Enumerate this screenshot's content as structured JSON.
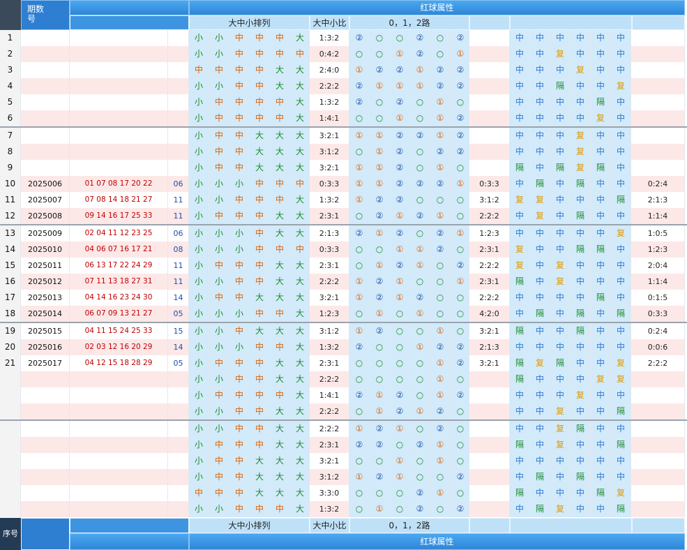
{
  "header": {
    "col_issue": "期数",
    "col_issue2": "号",
    "red_attr": "红球属性",
    "size_arrange": "大中小排列",
    "size_ratio": "大中小比",
    "route": "0，1，2路"
  },
  "footer": {
    "seq": "序号",
    "size_arrange": "大中小排列",
    "size_ratio": "大中小比",
    "route": "0，1，2路",
    "red_attr": "红球属性"
  },
  "rows": [
    {
      "seq": "1",
      "issue": "",
      "nums": "",
      "blue": "",
      "size": [
        "小",
        "小",
        "中",
        "中",
        "中",
        "大"
      ],
      "ratio": "1:3:2",
      "route": [
        "②",
        "○",
        "○",
        "②",
        "○",
        "②"
      ],
      "r2": "",
      "f": [
        "中",
        "中",
        "中",
        "中",
        "中",
        "中"
      ],
      "tail": ""
    },
    {
      "seq": "2",
      "issue": "",
      "nums": "",
      "blue": "",
      "size": [
        "小",
        "小",
        "中",
        "中",
        "中",
        "中"
      ],
      "ratio": "0:4:2",
      "route": [
        "○",
        "○",
        "①",
        "②",
        "○",
        "①"
      ],
      "r2": "",
      "f": [
        "中",
        "中",
        "复",
        "中",
        "中",
        "中"
      ],
      "tail": ""
    },
    {
      "seq": "3",
      "issue": "",
      "nums": "",
      "blue": "",
      "size": [
        "中",
        "中",
        "中",
        "中",
        "大",
        "大"
      ],
      "ratio": "2:4:0",
      "route": [
        "①",
        "②",
        "②",
        "①",
        "②",
        "②"
      ],
      "r2": "",
      "f": [
        "中",
        "中",
        "中",
        "复",
        "中",
        "中"
      ],
      "tail": ""
    },
    {
      "seq": "4",
      "issue": "",
      "nums": "",
      "blue": "",
      "size": [
        "小",
        "小",
        "中",
        "中",
        "大",
        "大"
      ],
      "ratio": "2:2:2",
      "route": [
        "②",
        "①",
        "①",
        "①",
        "②",
        "②"
      ],
      "r2": "",
      "f": [
        "中",
        "中",
        "隔",
        "中",
        "中",
        "复"
      ],
      "tail": ""
    },
    {
      "seq": "5",
      "issue": "",
      "nums": "",
      "blue": "",
      "size": [
        "小",
        "中",
        "中",
        "中",
        "中",
        "大"
      ],
      "ratio": "1:3:2",
      "route": [
        "②",
        "○",
        "②",
        "○",
        "①",
        "○"
      ],
      "r2": "",
      "f": [
        "中",
        "中",
        "中",
        "中",
        "隔",
        "中"
      ],
      "tail": ""
    },
    {
      "seq": "6",
      "issue": "",
      "nums": "",
      "blue": "",
      "size": [
        "小",
        "中",
        "中",
        "中",
        "中",
        "大"
      ],
      "ratio": "1:4:1",
      "route": [
        "○",
        "○",
        "①",
        "○",
        "①",
        "②"
      ],
      "r2": "",
      "f": [
        "中",
        "中",
        "中",
        "中",
        "复",
        "中"
      ],
      "tail": ""
    },
    {
      "seq": "7",
      "issue": "",
      "nums": "",
      "blue": "",
      "size": [
        "小",
        "中",
        "中",
        "大",
        "大",
        "大"
      ],
      "ratio": "3:2:1",
      "route": [
        "①",
        "①",
        "②",
        "②",
        "①",
        "②"
      ],
      "r2": "",
      "f": [
        "中",
        "中",
        "中",
        "复",
        "中",
        "中"
      ],
      "tail": ""
    },
    {
      "seq": "8",
      "issue": "",
      "nums": "",
      "blue": "",
      "size": [
        "小",
        "中",
        "中",
        "大",
        "大",
        "大"
      ],
      "ratio": "3:1:2",
      "route": [
        "○",
        "①",
        "②",
        "○",
        "②",
        "②"
      ],
      "r2": "",
      "f": [
        "中",
        "中",
        "中",
        "复",
        "中",
        "中"
      ],
      "tail": ""
    },
    {
      "seq": "9",
      "issue": "",
      "nums": "",
      "blue": "",
      "size": [
        "小",
        "中",
        "中",
        "大",
        "大",
        "大"
      ],
      "ratio": "3:2:1",
      "route": [
        "①",
        "①",
        "②",
        "○",
        "①",
        "○"
      ],
      "r2": "",
      "f": [
        "隔",
        "中",
        "隔",
        "复",
        "隔",
        "中"
      ],
      "tail": ""
    },
    {
      "seq": "10",
      "issue": "2025006",
      "nums": "01 07 08 17 20 22",
      "blue": "06",
      "size": [
        "小",
        "小",
        "小",
        "中",
        "中",
        "中"
      ],
      "ratio": "0:3:3",
      "route": [
        "①",
        "①",
        "②",
        "②",
        "②",
        "①"
      ],
      "r2": "0:3:3",
      "f": [
        "中",
        "隔",
        "中",
        "隔",
        "中",
        "中"
      ],
      "tail": "0:2:4"
    },
    {
      "seq": "11",
      "issue": "2025007",
      "nums": "07 08 14 18 21 27",
      "blue": "11",
      "size": [
        "小",
        "小",
        "中",
        "中",
        "中",
        "大"
      ],
      "ratio": "1:3:2",
      "route": [
        "①",
        "②",
        "②",
        "○",
        "○",
        "○"
      ],
      "r2": "3:1:2",
      "f": [
        "复",
        "复",
        "中",
        "中",
        "中",
        "隔"
      ],
      "tail": "2:1:3"
    },
    {
      "seq": "12",
      "issue": "2025008",
      "nums": "09 14 16 17 25 33",
      "blue": "11",
      "size": [
        "小",
        "中",
        "中",
        "中",
        "大",
        "大"
      ],
      "ratio": "2:3:1",
      "route": [
        "○",
        "②",
        "①",
        "②",
        "①",
        "○"
      ],
      "r2": "2:2:2",
      "f": [
        "中",
        "复",
        "中",
        "隔",
        "中",
        "中"
      ],
      "tail": "1:1:4"
    },
    {
      "seq": "13",
      "issue": "2025009",
      "nums": "02 04 11 12 23 25",
      "blue": "06",
      "size": [
        "小",
        "小",
        "小",
        "中",
        "大",
        "大"
      ],
      "ratio": "2:1:3",
      "route": [
        "②",
        "①",
        "②",
        "○",
        "②",
        "①"
      ],
      "r2": "1:2:3",
      "f": [
        "中",
        "中",
        "中",
        "中",
        "中",
        "复"
      ],
      "tail": "1:0:5"
    },
    {
      "seq": "14",
      "issue": "2025010",
      "nums": "04 06 07 16 17 21",
      "blue": "08",
      "size": [
        "小",
        "小",
        "小",
        "中",
        "中",
        "中"
      ],
      "ratio": "0:3:3",
      "route": [
        "○",
        "○",
        "①",
        "①",
        "②",
        "○"
      ],
      "r2": "2:3:1",
      "f": [
        "复",
        "中",
        "中",
        "隔",
        "隔",
        "中"
      ],
      "tail": "1:2:3"
    },
    {
      "seq": "15",
      "issue": "2025011",
      "nums": "06 13 17 22 24 29",
      "blue": "11",
      "size": [
        "小",
        "中",
        "中",
        "中",
        "大",
        "大"
      ],
      "ratio": "2:3:1",
      "route": [
        "○",
        "①",
        "②",
        "①",
        "○",
        "②"
      ],
      "r2": "2:2:2",
      "f": [
        "复",
        "中",
        "复",
        "中",
        "中",
        "中"
      ],
      "tail": "2:0:4"
    },
    {
      "seq": "16",
      "issue": "2025012",
      "nums": "07 11 13 18 27 31",
      "blue": "11",
      "size": [
        "小",
        "小",
        "中",
        "中",
        "大",
        "大"
      ],
      "ratio": "2:2:2",
      "route": [
        "①",
        "②",
        "①",
        "○",
        "○",
        "①"
      ],
      "r2": "2:3:1",
      "f": [
        "隔",
        "中",
        "复",
        "中",
        "中",
        "中"
      ],
      "tail": "1:1:4"
    },
    {
      "seq": "17",
      "issue": "2025013",
      "nums": "04 14 16 23 24 30",
      "blue": "14",
      "size": [
        "小",
        "中",
        "中",
        "大",
        "大",
        "大"
      ],
      "ratio": "3:2:1",
      "route": [
        "①",
        "②",
        "①",
        "②",
        "○",
        "○"
      ],
      "r2": "2:2:2",
      "f": [
        "中",
        "中",
        "中",
        "中",
        "隔",
        "中"
      ],
      "tail": "0:1:5"
    },
    {
      "seq": "18",
      "issue": "2025014",
      "nums": "06 07 09 13 21 27",
      "blue": "05",
      "size": [
        "小",
        "小",
        "小",
        "中",
        "中",
        "大"
      ],
      "ratio": "1:2:3",
      "route": [
        "○",
        "①",
        "○",
        "①",
        "○",
        "○"
      ],
      "r2": "4:2:0",
      "f": [
        "中",
        "隔",
        "中",
        "隔",
        "中",
        "隔"
      ],
      "tail": "0:3:3"
    },
    {
      "seq": "19",
      "issue": "2025015",
      "nums": "04 11 15 24 25 33",
      "blue": "15",
      "size": [
        "小",
        "小",
        "中",
        "大",
        "大",
        "大"
      ],
      "ratio": "3:1:2",
      "route": [
        "①",
        "②",
        "○",
        "○",
        "①",
        "○"
      ],
      "r2": "3:2:1",
      "f": [
        "隔",
        "中",
        "中",
        "隔",
        "中",
        "中"
      ],
      "tail": "0:2:4"
    },
    {
      "seq": "20",
      "issue": "2025016",
      "nums": "02 03 12 16 20 29",
      "blue": "14",
      "size": [
        "小",
        "小",
        "小",
        "中",
        "中",
        "大"
      ],
      "ratio": "1:3:2",
      "route": [
        "②",
        "○",
        "○",
        "①",
        "②",
        "②"
      ],
      "r2": "2:1:3",
      "f": [
        "中",
        "中",
        "中",
        "中",
        "中",
        "中"
      ],
      "tail": "0:0:6"
    },
    {
      "seq": "21",
      "issue": "2025017",
      "nums": "04 12 15 18 28 29",
      "blue": "05",
      "size": [
        "小",
        "中",
        "中",
        "中",
        "大",
        "大"
      ],
      "ratio": "2:3:1",
      "route": [
        "○",
        "○",
        "○",
        "○",
        "①",
        "②"
      ],
      "r2": "3:2:1",
      "f": [
        "隔",
        "复",
        "隔",
        "中",
        "中",
        "复"
      ],
      "tail": "2:2:2"
    },
    {
      "seq": "",
      "issue": "",
      "nums": "",
      "blue": "",
      "size": [
        "小",
        "小",
        "中",
        "中",
        "大",
        "大"
      ],
      "ratio": "2:2:2",
      "route": [
        "○",
        "○",
        "○",
        "○",
        "①",
        "○"
      ],
      "r2": "",
      "f": [
        "隔",
        "中",
        "中",
        "中",
        "复",
        "复"
      ],
      "tail": ""
    },
    {
      "seq": "",
      "issue": "",
      "nums": "",
      "blue": "",
      "size": [
        "小",
        "中",
        "中",
        "中",
        "中",
        "大"
      ],
      "ratio": "1:4:1",
      "route": [
        "②",
        "①",
        "②",
        "○",
        "①",
        "②"
      ],
      "r2": "",
      "f": [
        "中",
        "中",
        "中",
        "复",
        "中",
        "中"
      ],
      "tail": ""
    },
    {
      "seq": "",
      "issue": "",
      "nums": "",
      "blue": "",
      "size": [
        "小",
        "小",
        "中",
        "中",
        "大",
        "大"
      ],
      "ratio": "2:2:2",
      "route": [
        "○",
        "①",
        "②",
        "①",
        "②",
        "○"
      ],
      "r2": "",
      "f": [
        "中",
        "中",
        "复",
        "中",
        "中",
        "隔"
      ],
      "tail": ""
    },
    {
      "seq": "",
      "issue": "",
      "nums": "",
      "blue": "",
      "size": [
        "小",
        "小",
        "中",
        "中",
        "大",
        "大"
      ],
      "ratio": "2:2:2",
      "route": [
        "①",
        "②",
        "①",
        "○",
        "②",
        "○"
      ],
      "r2": "",
      "f": [
        "中",
        "中",
        "复",
        "隔",
        "中",
        "中"
      ],
      "tail": ""
    },
    {
      "seq": "",
      "issue": "",
      "nums": "",
      "blue": "",
      "size": [
        "小",
        "中",
        "中",
        "中",
        "大",
        "大"
      ],
      "ratio": "2:3:1",
      "route": [
        "②",
        "②",
        "○",
        "②",
        "①",
        "○"
      ],
      "r2": "",
      "f": [
        "隔",
        "中",
        "复",
        "中",
        "中",
        "隔"
      ],
      "tail": ""
    },
    {
      "seq": "",
      "issue": "",
      "nums": "",
      "blue": "",
      "size": [
        "小",
        "中",
        "中",
        "大",
        "大",
        "大"
      ],
      "ratio": "3:2:1",
      "route": [
        "○",
        "○",
        "①",
        "○",
        "①",
        "○"
      ],
      "r2": "",
      "f": [
        "中",
        "中",
        "中",
        "中",
        "中",
        "中"
      ],
      "tail": ""
    },
    {
      "seq": "",
      "issue": "",
      "nums": "",
      "blue": "",
      "size": [
        "小",
        "中",
        "中",
        "大",
        "大",
        "大"
      ],
      "ratio": "3:1:2",
      "route": [
        "①",
        "②",
        "①",
        "○",
        "○",
        "②"
      ],
      "r2": "",
      "f": [
        "中",
        "隔",
        "中",
        "隔",
        "中",
        "中"
      ],
      "tail": ""
    },
    {
      "seq": "",
      "issue": "",
      "nums": "",
      "blue": "",
      "size": [
        "中",
        "中",
        "中",
        "大",
        "大",
        "大"
      ],
      "ratio": "3:3:0",
      "route": [
        "○",
        "○",
        "○",
        "②",
        "①",
        "○"
      ],
      "r2": "",
      "f": [
        "隔",
        "中",
        "中",
        "中",
        "隔",
        "复"
      ],
      "tail": ""
    },
    {
      "seq": "",
      "issue": "",
      "nums": "",
      "blue": "",
      "size": [
        "小",
        "小",
        "中",
        "中",
        "中",
        "大"
      ],
      "ratio": "1:3:2",
      "route": [
        "○",
        "①",
        "○",
        "②",
        "○",
        "②"
      ],
      "r2": "",
      "f": [
        "中",
        "隔",
        "复",
        "中",
        "中",
        "隔"
      ],
      "tail": ""
    }
  ]
}
